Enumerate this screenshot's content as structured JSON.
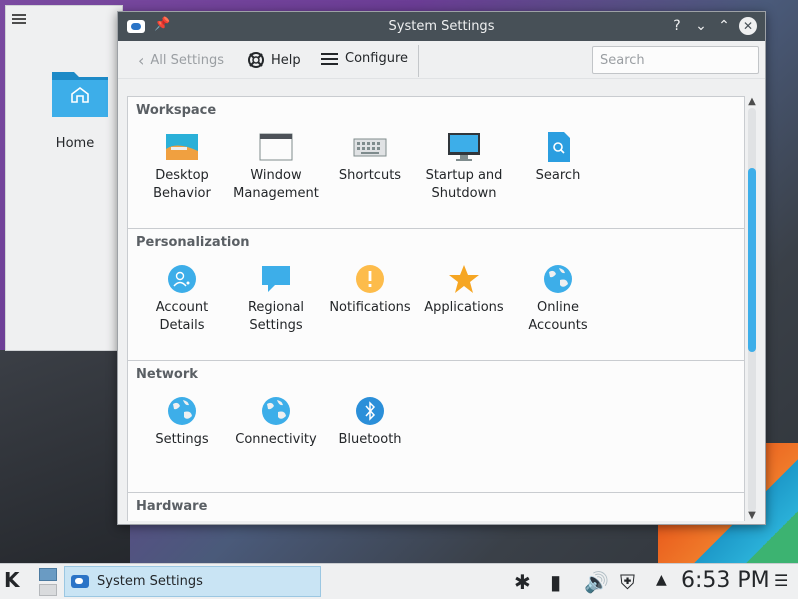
{
  "desktop": {
    "folder_item": "Home"
  },
  "window": {
    "title": "System Settings",
    "buttons": {
      "help": "?",
      "minimize": "⌄",
      "maximize": "⌃",
      "close": "✕"
    }
  },
  "toolbar": {
    "back_label": "All Settings",
    "help_label": "Help",
    "configure_label": "Configure",
    "search_placeholder": "Search"
  },
  "groups": [
    {
      "title": "Workspace",
      "items": [
        {
          "label": "Desktop\nBehavior"
        },
        {
          "label": "Window\nManagement"
        },
        {
          "label": "Shortcuts"
        },
        {
          "label": "Startup and\nShutdown"
        },
        {
          "label": "Search"
        }
      ]
    },
    {
      "title": "Personalization",
      "items": [
        {
          "label": "Account\nDetails"
        },
        {
          "label": "Regional\nSettings"
        },
        {
          "label": "Notifications"
        },
        {
          "label": "Applications"
        },
        {
          "label": "Online\nAccounts"
        }
      ]
    },
    {
      "title": "Network",
      "items": [
        {
          "label": "Settings"
        },
        {
          "label": "Connectivity"
        },
        {
          "label": "Bluetooth"
        }
      ]
    },
    {
      "title": "Hardware",
      "items": []
    }
  ],
  "taskbar": {
    "task_label": "System Settings",
    "clock": "6:53 PM"
  },
  "colors": {
    "accent": "#3daee9",
    "titlebar": "#475057",
    "panel": "#eff0f1"
  }
}
